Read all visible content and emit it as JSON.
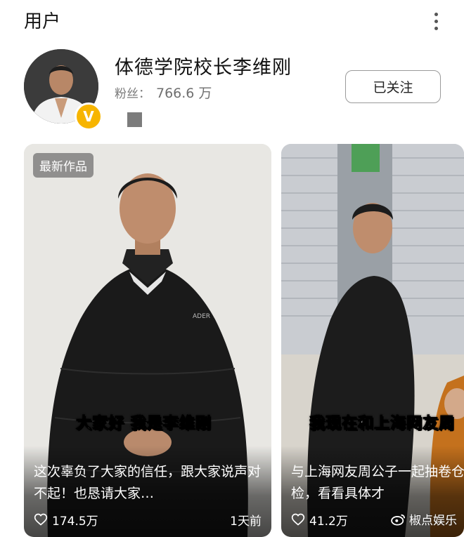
{
  "header": {
    "title": "用户"
  },
  "user": {
    "name": "体德学院校长李维刚",
    "fans_label": "粉丝：",
    "fans_count": "766.6 万",
    "verified_mark": "V",
    "follow_label": "已关注"
  },
  "cards": [
    {
      "badge": "最新作品",
      "subtitle": "大家好 我是李维刚",
      "text": "这次辜负了大家的信任，跟大家说声对不起！也恳请大家…",
      "likes": "174.5万",
      "age": "1天前"
    },
    {
      "subtitle": "我现在和上海网友周",
      "text": "与上海网友周公子一起抽卷仓库抽检，看看具体才",
      "likes": "41.2万"
    }
  ],
  "watermark": {
    "text": "椒点娱乐"
  },
  "colors": {
    "verified_badge": "#f7b500",
    "card_text": "#ffffff"
  }
}
